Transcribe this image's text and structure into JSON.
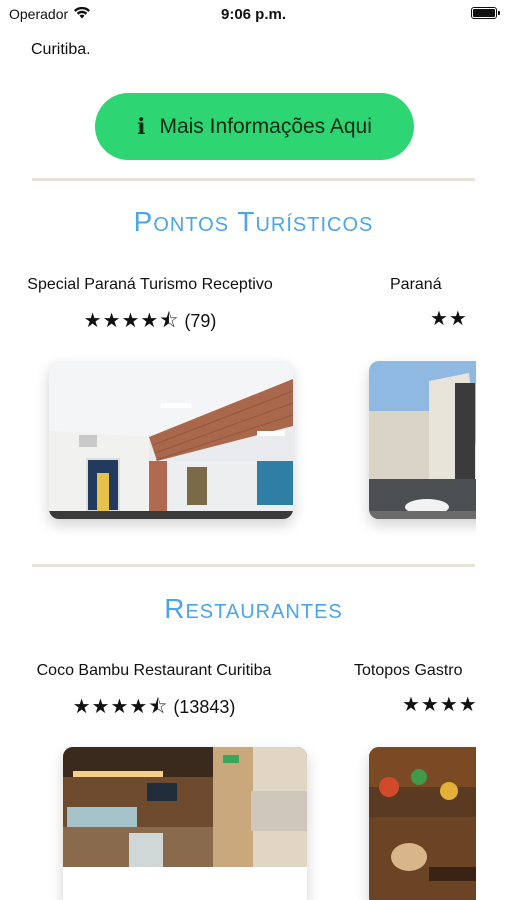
{
  "status_bar": {
    "carrier": "Operador",
    "time": "9:06 p.m."
  },
  "intro": {
    "text": "Curitiba."
  },
  "info_button": {
    "label": "Mais Informações Aqui",
    "icon": "info-icon"
  },
  "tourism": {
    "title": "Pontos Turísticos",
    "items": [
      {
        "name": "Special Paraná Turismo Receptivo",
        "stars": "★★★★⯪",
        "count": "(79)"
      },
      {
        "name": "Paraná",
        "stars": "★★",
        "count": ""
      }
    ]
  },
  "restaurants": {
    "title": "Restaurantes",
    "items": [
      {
        "name": "Coco Bambu Restaurant Curitiba",
        "stars": "★★★★⯪",
        "count": "(13843)"
      },
      {
        "name": "Totopos Gastro",
        "stars": "★★★★",
        "count": ""
      }
    ]
  },
  "colors": {
    "accent": "#2ed573",
    "section_title": "#4aa6e8",
    "divider": "#e8e3d8"
  }
}
